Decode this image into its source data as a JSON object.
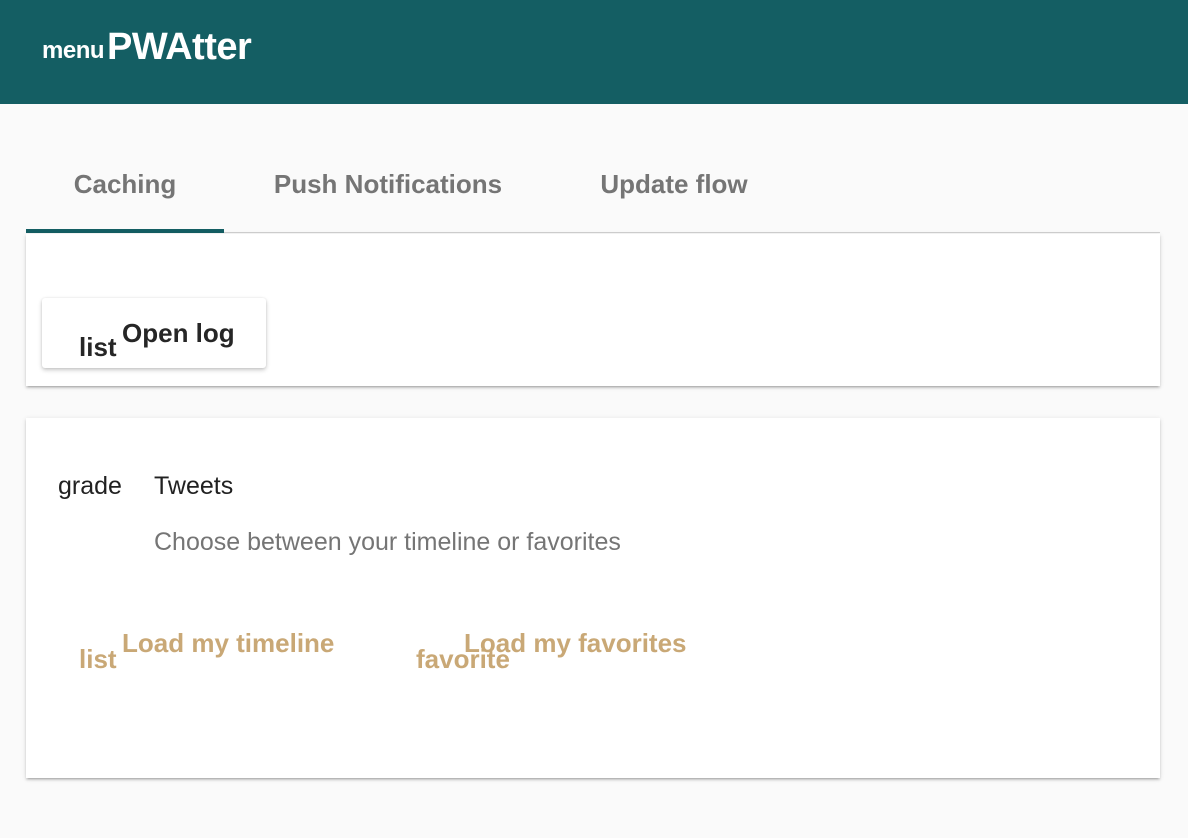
{
  "toolbar": {
    "menu_icon": "menu",
    "title": "PWAtter",
    "background": "#145e63"
  },
  "tabs": [
    {
      "label": "Caching",
      "active": true
    },
    {
      "label": "Push Notifications",
      "active": false
    },
    {
      "label": "Update flow",
      "active": false
    }
  ],
  "log_card": {
    "button_icon": "list",
    "button_label": "Open log"
  },
  "tweets_card": {
    "avatar_icon": "grade",
    "title": "Tweets",
    "subtitle": "Choose between your timeline or favorites",
    "actions": [
      {
        "icon": "list",
        "label": "Load my timeline"
      },
      {
        "icon": "favorite",
        "label": "Load my favorites"
      }
    ],
    "accent": "#c9a876"
  }
}
